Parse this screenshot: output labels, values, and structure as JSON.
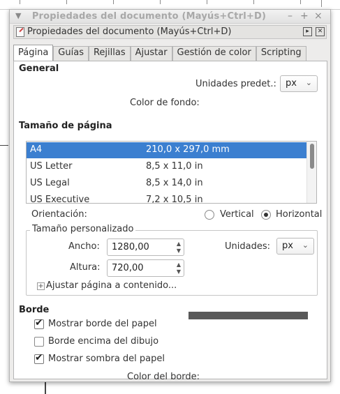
{
  "window": {
    "title": "Propiedades del documento (Mayús+Ctrl+D)",
    "dock_title": "Propiedades del documento (Mayús+Ctrl+D)"
  },
  "tabs": [
    {
      "label": "Página",
      "active": true
    },
    {
      "label": "Guías",
      "active": false
    },
    {
      "label": "Rejillas",
      "active": false
    },
    {
      "label": "Ajustar",
      "active": false
    },
    {
      "label": "Gestión de color",
      "active": false
    },
    {
      "label": "Scripting",
      "active": false
    }
  ],
  "general": {
    "heading": "General",
    "units_label": "Unidades predet.:",
    "units_value": "px",
    "background_label": "Color de fondo:"
  },
  "page_size": {
    "heading": "Tamaño de página",
    "rows": [
      {
        "name": "A4",
        "size": "210,0 x 297,0 mm",
        "selected": true
      },
      {
        "name": "US Letter",
        "size": "8,5 x 11,0 in",
        "selected": false
      },
      {
        "name": "US Legal",
        "size": "8,5 x 14,0 in",
        "selected": false
      },
      {
        "name": "US Executive",
        "size": "7,2 x 10,5 in",
        "selected": false
      }
    ],
    "orientation_label": "Orientación:",
    "vertical_label": "Vertical",
    "horizontal_label": "Horizontal",
    "orientation_selected": "Horizontal"
  },
  "custom_size": {
    "title": "Tamaño personalizado",
    "width_label": "Ancho:",
    "width_value": "1280,00",
    "height_label": "Altura:",
    "height_value": "720,00",
    "units_label": "Unidades:",
    "units_value": "px",
    "fit_label": "Ajustar página a contenido..."
  },
  "border": {
    "heading": "Borde",
    "show_border_label": "Mostrar borde del papel",
    "show_border_checked": true,
    "border_on_top_label": "Borde encima del dibujo",
    "border_on_top_checked": false,
    "show_shadow_label": "Mostrar sombra del papel",
    "show_shadow_checked": true,
    "border_color_label": "Color del borde:",
    "border_color": "#595959"
  },
  "colors": {
    "selection": "#3b7fd0"
  }
}
